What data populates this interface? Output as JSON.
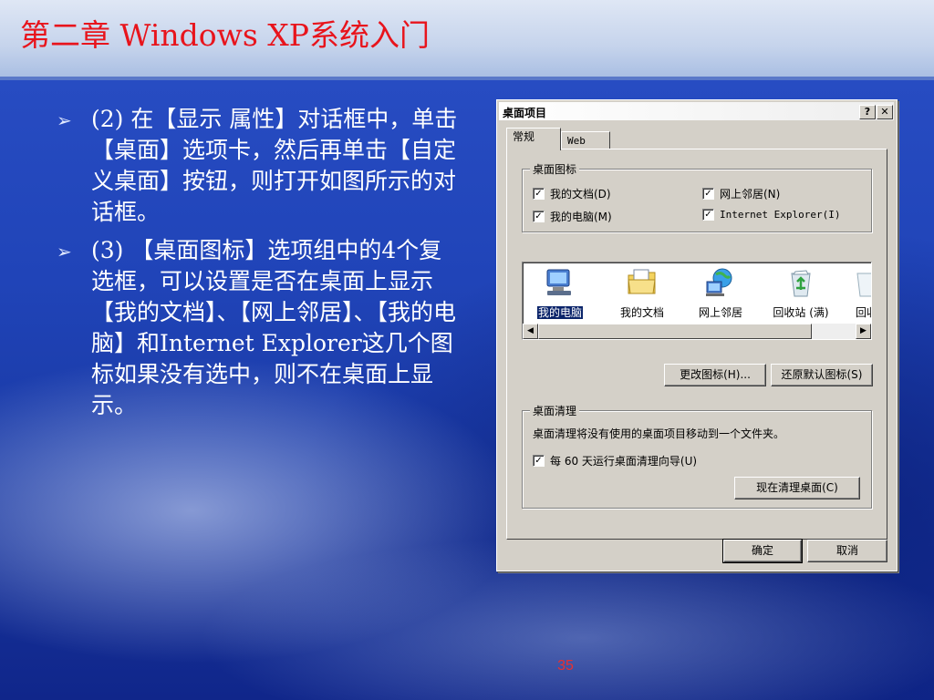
{
  "slide": {
    "title": "第二章 Windows XP系统入门",
    "bullets": [
      {
        "icon": "arrow-bullet-icon",
        "text": "(2)  在【显示 属性】对话框中，单击【桌面】选项卡，然后再单击【自定义桌面】按钮，则打开如图所示的对话框。"
      },
      {
        "icon": "arrow-bullet-icon",
        "text": "(3) 【桌面图标】选项组中的4个复选框，可以设置是否在桌面上显示【我的文档】、【网上邻居】、【我的电脑】和Internet Explorer这几个图标如果没有选中，则不在桌面上显示。"
      }
    ],
    "page_number": "35"
  },
  "dialog": {
    "title": "桌面项目",
    "help_label": "?",
    "close_label": "✕",
    "tabs": [
      {
        "label": "常规",
        "active": true
      },
      {
        "label": "Web",
        "active": false
      }
    ],
    "desktop_icons_group": {
      "label": "桌面图标",
      "checkboxes": [
        {
          "label": "我的文档(D)",
          "checked": true
        },
        {
          "label": "网上邻居(N)",
          "checked": true
        },
        {
          "label": "我的电脑(M)",
          "checked": true
        },
        {
          "label": "Internet Explorer(I)",
          "checked": true
        }
      ]
    },
    "icon_list": [
      {
        "icon": "my-computer-icon",
        "label": "我的电脑",
        "selected": true
      },
      {
        "icon": "my-documents-icon",
        "label": "我的文档",
        "selected": false
      },
      {
        "icon": "network-places-icon",
        "label": "网上邻居",
        "selected": false
      },
      {
        "icon": "recycle-bin-full-icon",
        "label": "回收站 (满)",
        "selected": false
      },
      {
        "icon": "recycle-bin-empty-icon",
        "label": "回收",
        "selected": false
      }
    ],
    "change_icon_button": "更改图标(H)...",
    "restore_default_button": "还原默认图标(S)",
    "cleanup_group": {
      "label": "桌面清理",
      "description": "桌面清理将没有使用的桌面项目移动到一个文件夹。",
      "checkbox": {
        "label": "每 60 天运行桌面清理向导(U)",
        "checked": true
      },
      "clean_now_button": "现在清理桌面(C)"
    },
    "ok_button": "确定",
    "cancel_button": "取消"
  },
  "colors": {
    "title_red": "#e8141c",
    "slide_blue": "#2044b8",
    "dialog_gray": "#d4d0c8",
    "selection_blue": "#0a246a"
  }
}
